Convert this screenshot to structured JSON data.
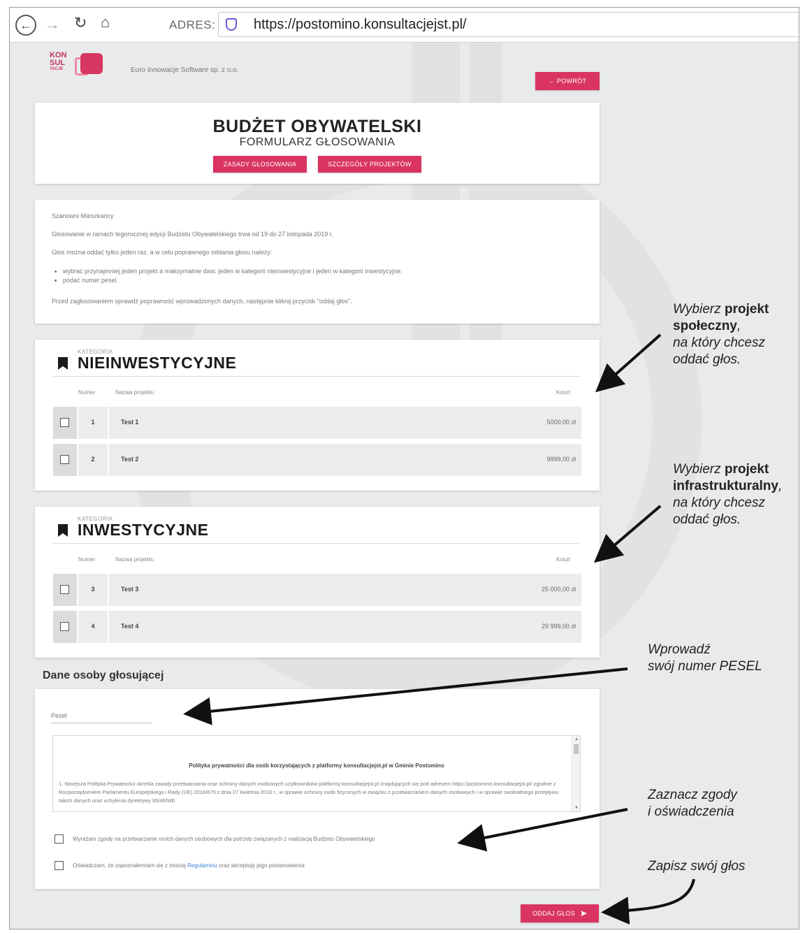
{
  "browser": {
    "address_label": "ADRES:",
    "url": "https://postomino.konsultacjejst.pl/"
  },
  "header": {
    "logo_text": [
      "KON",
      "SUL",
      "TACJE"
    ],
    "company": "Euro Innowacje Software sp. z o.o.",
    "back_button": "← POWRÓT"
  },
  "hero": {
    "title": "BUDŻET OBYWATELSKI",
    "subtitle": "FORMULARZ GŁOSOWANIA",
    "rules_button": "ZASADY GŁOSOWANIA",
    "details_button": "SZCZEGÓŁY PROJEKTÓW"
  },
  "intro": {
    "greeting": "Szanowni Mieszkańcy",
    "line1": "Głosowanie w ramach tegorocznej edycji Budżetu Obywatelskiego trwa od 19 do 27 listopada 2019 r.",
    "line2": "Głos można oddać tylko jeden raz, a w celu poprawnego oddania głosu należy:",
    "bullets": [
      "wybrać przynajmniej jeden projekt a maksymalnie dwa: jeden w kategorii nieinwestycyjne i jeden w kategorii inwestycyjne,",
      "podać numer pesel."
    ],
    "line3": "Przed zagłosowaniem sprawdź poprawność wprowadzonych danych, następnie kliknij przycisk \"oddaj głos\"."
  },
  "categories": [
    {
      "annotation": "KATEGORIA",
      "title": "NIEINWESTYCYJNE",
      "col_number": "Numer",
      "col_name": "Nazwa projektu",
      "col_cost": "Koszt",
      "rows": [
        {
          "number": "1",
          "name": "Test 1",
          "cost": "5000,00 zł"
        },
        {
          "number": "2",
          "name": "Test 2",
          "cost": "9999,00 zł"
        }
      ]
    },
    {
      "annotation": "KATEGORIA",
      "title": "INWESTYCYJNE",
      "col_number": "Numer",
      "col_name": "Nazwa projektu",
      "col_cost": "Koszt",
      "rows": [
        {
          "number": "3",
          "name": "Test 3",
          "cost": "25 000,00 zł"
        },
        {
          "number": "4",
          "name": "Test 4",
          "cost": "29 999,00 zł"
        }
      ]
    }
  ],
  "voter": {
    "heading": "Dane osoby głosującej",
    "pesel_placeholder": "Pesel",
    "policy_title": "Polityka prywatności dla osób korzystających z platformy konsultacjejst.pl w Gminie Postomino",
    "policy_body": "1. Niniejsza Polityka Prywatności określa zasady przetwarzania oraz ochrony danych osobowych użytkowników platformy konsultacjejst.pl znajdujących się pod adresem https://postomino.konsultacjejst.pl/ zgodnie z Rozporządzeniem Parlamentu Europejskiego i Rady (UE) 2016/679 z dnia 27 kwietnia 2016 r., w sprawie ochrony osób fizycznych w związku z przetwarzaniem danych osobowych i w sprawie swobodnego przepływu takich danych oraz uchylenia dyrektywy 95/46/WE",
    "consent1": "Wyrażam zgodę na przetwarzanie moich danych osobowych dla potrzeb związanych z realizacją Budżetu Obywatelskiego",
    "consent2_prefix": "Oświadczam, że zapoznałem/am się z treścią",
    "consent2_link": "Regulaminu",
    "consent2_suffix": "oraz akceptuję jego postanowienia",
    "submit_button": "ODDAJ GŁOS"
  },
  "annotations": {
    "note1": {
      "pre": "Wybierz",
      "bold1": "projekt",
      "bold2": "społeczny",
      "post1": ",",
      "line3": "na który chcesz",
      "line4": "oddać głos."
    },
    "note2": {
      "pre": "Wybierz",
      "bold1": "projekt",
      "bold2": "infrastrukturalny",
      "post1": ",",
      "line3": "na który chcesz",
      "line4": "oddać głos."
    },
    "note3": {
      "line1": "Wprowadź",
      "line2": "swój numer PESEL"
    },
    "note4": {
      "line1": "Zaznacz zgody",
      "line2": "i oświadczenia"
    },
    "note5": {
      "line1": "Zapisz swój głos"
    }
  },
  "colors": {
    "accent": "#d93462",
    "link": "#3a82d8"
  },
  "icons": [
    "back-arrow-icon",
    "forward-arrow-icon",
    "reload-icon",
    "home-icon",
    "shield-icon",
    "bookmark-icon",
    "send-icon"
  ]
}
